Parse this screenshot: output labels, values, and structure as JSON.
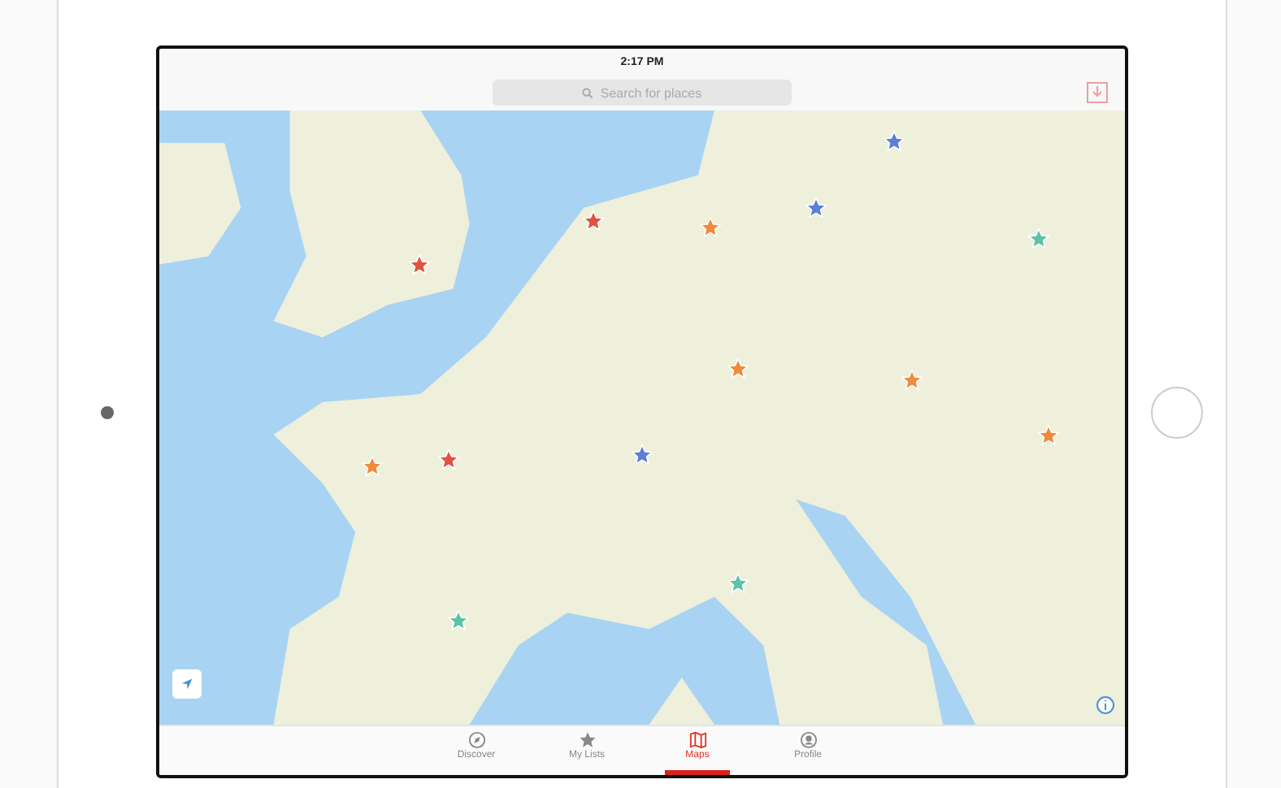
{
  "status_bar": {
    "time": "2:17 PM"
  },
  "search": {
    "placeholder": "Search for places"
  },
  "pins": [
    {
      "color": "#5b7fd8"
    },
    {
      "color": "#e0533f"
    },
    {
      "color": "#f08a3c"
    },
    {
      "color": "#5b7fd8"
    },
    {
      "color": "#5cc3a8"
    },
    {
      "color": "#e0533f"
    },
    {
      "color": "#f08a3c"
    },
    {
      "color": "#f08a3c"
    },
    {
      "color": "#f08a3c"
    },
    {
      "color": "#f08a3c"
    },
    {
      "color": "#e0533f"
    },
    {
      "color": "#5b7fd8"
    },
    {
      "color": "#5cc3a8"
    },
    {
      "color": "#5cc3a8"
    }
  ],
  "tabs": [
    {
      "kind": "compass",
      "label": "Discover",
      "selected": false
    },
    {
      "kind": "star",
      "label": "My Lists",
      "selected": false
    },
    {
      "kind": "map",
      "label": "Maps",
      "selected": true
    },
    {
      "kind": "profile",
      "label": "Profile",
      "selected": false
    }
  ]
}
